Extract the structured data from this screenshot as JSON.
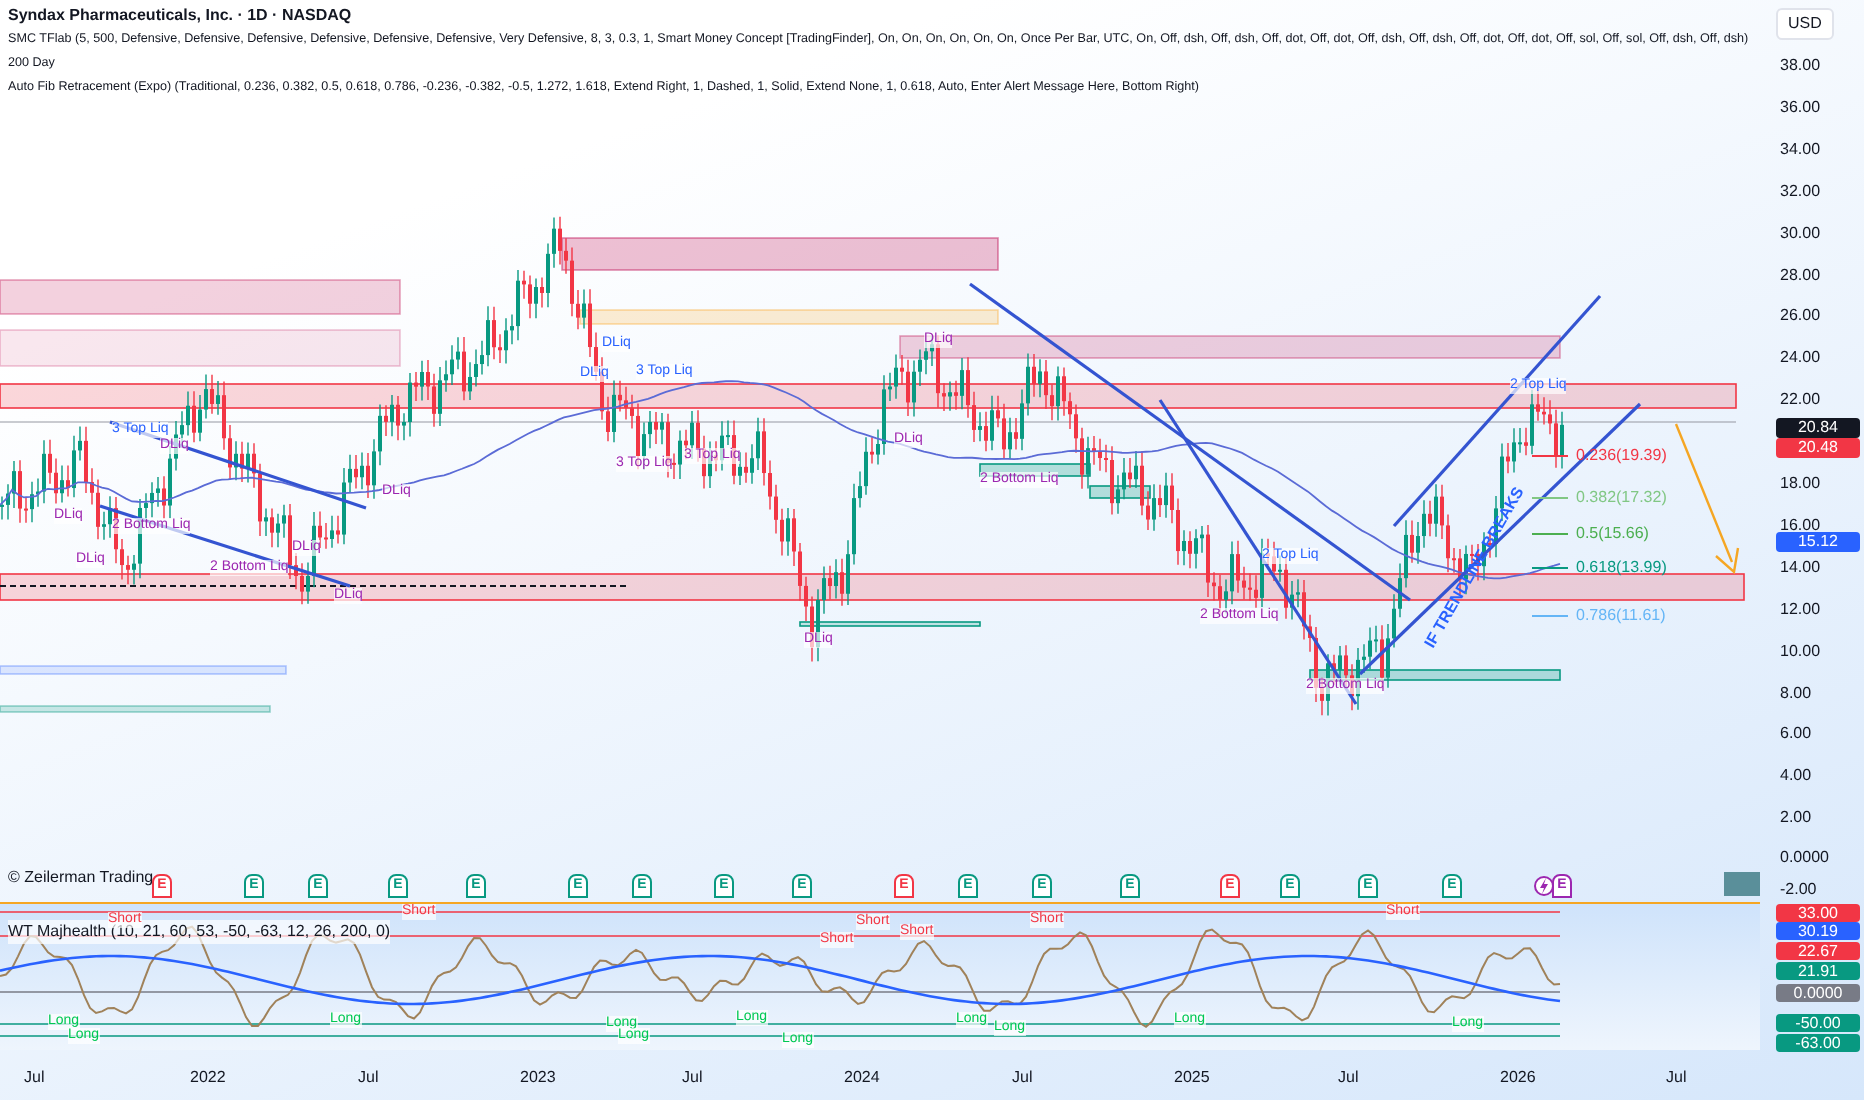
{
  "header": {
    "title": "Syndax Pharmaceuticals, Inc. · 1D · NASDAQ",
    "indicators": [
      "SMC TFlab (5, 500, Defensive, Defensive, Defensive, Defensive, Defensive, Defensive, Very Defensive, 8, 3, 0.3, 1, Smart Money Concept [TradingFinder], On, On, On, On, On, On, Once Per Bar, UTC, On, Off, dsh, Off, dsh, Off, dot, Off, dot, Off, dsh, Off, dsh, Off, dot, Off, dot, Off, sol, Off, sol, Off, dsh, Off, dsh)",
      "200 Day",
      "Auto Fib Retracement (Expo) (Traditional, 0.236, 0.382, 0.5, 0.618, 0.786, -0.236, -0.382, -0.5, 1.272, 1.618, Extend Right, 1, Dashed, 1, Solid, Extend None, 1, 0.618, Auto, Enter Alert Message Here, Bottom Right)"
    ]
  },
  "currency_button": "USD",
  "price_ticks": [
    "38.00",
    "36.00",
    "34.00",
    "32.00",
    "30.00",
    "28.00",
    "26.00",
    "24.00",
    "22.00",
    "18.00",
    "16.00",
    "14.00",
    "12.00",
    "10.00",
    "8.00",
    "6.00",
    "4.00",
    "2.00",
    "0.0000",
    "-2.00"
  ],
  "price_badges": [
    {
      "text": "20.84",
      "color": "#131722"
    },
    {
      "text": "20.48",
      "color": "#f23645"
    },
    {
      "text": "15.12",
      "color": "#2962ff"
    }
  ],
  "chart_labels": [
    {
      "kind": "top",
      "text": "3 Top Liq"
    },
    {
      "kind": "dliq",
      "text": "DLiq"
    },
    {
      "kind": "dliq",
      "text": "DLiq"
    },
    {
      "kind": "bottom",
      "text": "2 Bottom Liq"
    },
    {
      "kind": "dliq",
      "text": "DLiq"
    },
    {
      "kind": "bottom",
      "text": "2 Bottom Liq"
    },
    {
      "kind": "dliq",
      "text": "DLiq"
    },
    {
      "kind": "dliq",
      "text": "DLiq"
    },
    {
      "kind": "dliq",
      "text": "DLiq"
    },
    {
      "kind": "top",
      "text": "DLiq"
    },
    {
      "kind": "top",
      "text": "3 Top Liq"
    },
    {
      "kind": "bottom",
      "text": "3 Top Liq"
    },
    {
      "kind": "bottom",
      "text": "3 Top Liq"
    },
    {
      "kind": "dliq",
      "text": "DLiq"
    },
    {
      "kind": "bottom",
      "text": "DLiq"
    },
    {
      "kind": "dliq",
      "text": "DLiq"
    },
    {
      "kind": "top",
      "text": "DLiq"
    },
    {
      "kind": "bottom",
      "text": "2 Bottom Liq"
    },
    {
      "kind": "top",
      "text": "2 Top Liq"
    },
    {
      "kind": "bottom",
      "text": "2 Bottom Liq"
    },
    {
      "kind": "bottom",
      "text": "2 Bottom Liq"
    },
    {
      "kind": "top",
      "text": "2 Top Liq"
    }
  ],
  "fib_levels": [
    {
      "text": "0.236(19.39)",
      "color": "#f23645"
    },
    {
      "text": "0.382(17.32)",
      "color": "#81c784"
    },
    {
      "text": "0.5(15.66)",
      "color": "#4caf50"
    },
    {
      "text": "0.618(13.99)",
      "color": "#089981"
    },
    {
      "text": "0.786(11.61)",
      "color": "#64b5f6"
    }
  ],
  "annotation": "IF TRENDLINE BREAKS",
  "author_credit": "© Zeilerman Trading",
  "event_markers": [
    {
      "kind": "earnings",
      "text": "E",
      "color": "#f23645"
    },
    {
      "kind": "earnings",
      "text": "E",
      "color": "#089981"
    },
    {
      "kind": "earnings",
      "text": "E",
      "color": "#089981"
    },
    {
      "kind": "earnings",
      "text": "E",
      "color": "#089981"
    },
    {
      "kind": "earnings",
      "text": "E",
      "color": "#089981"
    },
    {
      "kind": "earnings",
      "text": "E",
      "color": "#089981"
    },
    {
      "kind": "earnings",
      "text": "E",
      "color": "#089981"
    },
    {
      "kind": "earnings",
      "text": "E",
      "color": "#089981"
    },
    {
      "kind": "earnings",
      "text": "E",
      "color": "#089981"
    },
    {
      "kind": "earnings",
      "text": "E",
      "color": "#f23645"
    },
    {
      "kind": "earnings",
      "text": "E",
      "color": "#089981"
    },
    {
      "kind": "earnings",
      "text": "E",
      "color": "#089981"
    },
    {
      "kind": "earnings",
      "text": "E",
      "color": "#089981"
    },
    {
      "kind": "earnings",
      "text": "E",
      "color": "#f23645"
    },
    {
      "kind": "earnings",
      "text": "E",
      "color": "#089981"
    },
    {
      "kind": "earnings",
      "text": "E",
      "color": "#089981"
    },
    {
      "kind": "earnings",
      "text": "E",
      "color": "#089981"
    },
    {
      "kind": "split",
      "color": "#9c27b0"
    },
    {
      "kind": "earnings",
      "text": "E",
      "color": "#9c27b0"
    }
  ],
  "indicator": {
    "title": "WT Majhealth (10, 21, 60, 53, -50, -63, 12, 26, 200, 0)",
    "badges": [
      {
        "text": "33.00",
        "color": "#f23645"
      },
      {
        "text": "30.19",
        "color": "#2962ff"
      },
      {
        "text": "22.67",
        "color": "#f23645"
      },
      {
        "text": "21.91",
        "color": "#089981"
      },
      {
        "text": "0.0000",
        "color": "#787b86"
      },
      {
        "text": "-50.00",
        "color": "#089981"
      },
      {
        "text": "-63.00",
        "color": "#089981"
      }
    ],
    "signals": [
      {
        "kind": "short",
        "text": "Short"
      },
      {
        "kind": "short",
        "text": "Short"
      },
      {
        "kind": "short",
        "text": "Short"
      },
      {
        "kind": "short",
        "text": "Short"
      },
      {
        "kind": "short",
        "text": "Short"
      },
      {
        "kind": "short",
        "text": "Short"
      },
      {
        "kind": "short",
        "text": "Short"
      },
      {
        "kind": "long",
        "text": "Long"
      },
      {
        "kind": "long",
        "text": "Long"
      },
      {
        "kind": "long",
        "text": "Long"
      },
      {
        "kind": "long",
        "text": "Long"
      },
      {
        "kind": "long",
        "text": "Long"
      },
      {
        "kind": "long",
        "text": "Long"
      },
      {
        "kind": "long",
        "text": "Long"
      },
      {
        "kind": "long",
        "text": "Long"
      },
      {
        "kind": "long",
        "text": "Long"
      },
      {
        "kind": "long",
        "text": "Long"
      },
      {
        "kind": "long",
        "text": "Long"
      }
    ]
  },
  "time_axis": [
    "Jul",
    "2022",
    "Jul",
    "2023",
    "Jul",
    "2024",
    "Jul",
    "2025",
    "Jul",
    "2026",
    "Jul"
  ]
}
